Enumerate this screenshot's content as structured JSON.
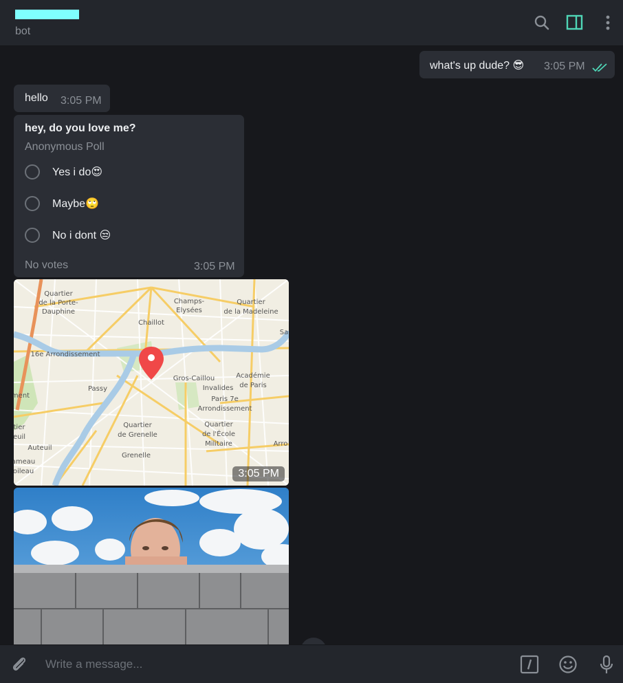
{
  "header": {
    "chat_status": "bot",
    "name_color": "#7fffff",
    "icons": [
      "search-icon",
      "sidebar-toggle-icon",
      "more-vertical-icon"
    ]
  },
  "messages": {
    "outgoing": {
      "text": "what's up dude? 😎",
      "time": "3:05 PM",
      "status_icon": "double-check-icon"
    },
    "hello": {
      "text": "hello",
      "time": "3:05 PM"
    },
    "poll": {
      "question": "hey, do you love me?",
      "type": "Anonymous Poll",
      "options": [
        "Yes i do😍",
        "Maybe🙄",
        "No i dont 😒"
      ],
      "votes": "No votes",
      "time": "3:05 PM"
    },
    "location": {
      "time": "3:05 PM",
      "map_labels": [
        "Quartier de la Porte-Dauphine",
        "Champs-Élysées",
        "Quartier de la Madeleine",
        "Chaillot",
        "16e Arrondissement",
        "Gros-Caillou",
        "Académie de Paris",
        "Invalides",
        "Paris 7e Arrondissement",
        "Passy",
        "Quartier de Grenelle",
        "Quartier de l'École Militaire",
        "Auteuil",
        "Grenelle",
        "Quartier",
        "Arro",
        "Sa",
        "ment",
        "tier",
        "euil",
        "ameau",
        "oileau",
        "Dauphine",
        "de la Porte-",
        "Quartier de la Madeleine"
      ]
    },
    "photo": {
      "alt_hint": ""
    }
  },
  "composer": {
    "placeholder": "Write a message...",
    "icons": [
      "attach-icon",
      "bot-command-icon",
      "emoji-icon",
      "microphone-icon"
    ]
  },
  "colors": {
    "accent": "#4fd6b6",
    "pin": "#f04848",
    "background": "#17181c",
    "panel": "#23262c",
    "bubble": "#2b2e35"
  }
}
